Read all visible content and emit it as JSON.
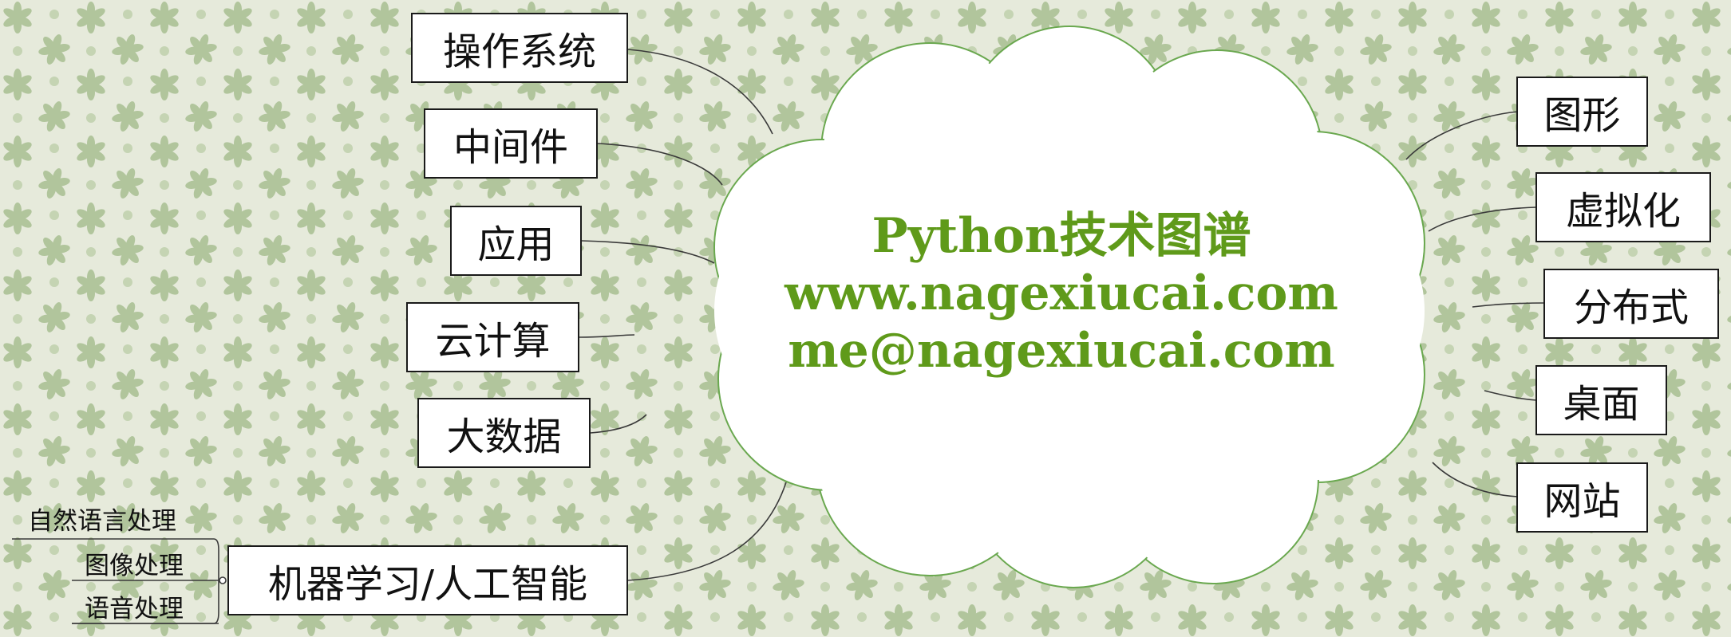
{
  "center": {
    "line1": "Python技术图谱",
    "line2": "www.nagexiucai.com",
    "line3": "me@nagexiucai.com",
    "text_color": "#5f9a1a"
  },
  "left_nodes": [
    "操作系统",
    "中间件",
    "应用",
    "云计算",
    "大数据",
    "机器学习/人工智能"
  ],
  "right_nodes": [
    "图形",
    "虚拟化",
    "分布式",
    "桌面",
    "网站"
  ],
  "ml_subitems": [
    "自然语言处理",
    "图像处理",
    "语音处理"
  ],
  "colors": {
    "background": "#e6eadb",
    "leaf_pattern": "#a9bf93",
    "cloud_fill": "#ffffff",
    "cloud_border": "#6aa84f",
    "box_border": "#1a1a1a"
  }
}
